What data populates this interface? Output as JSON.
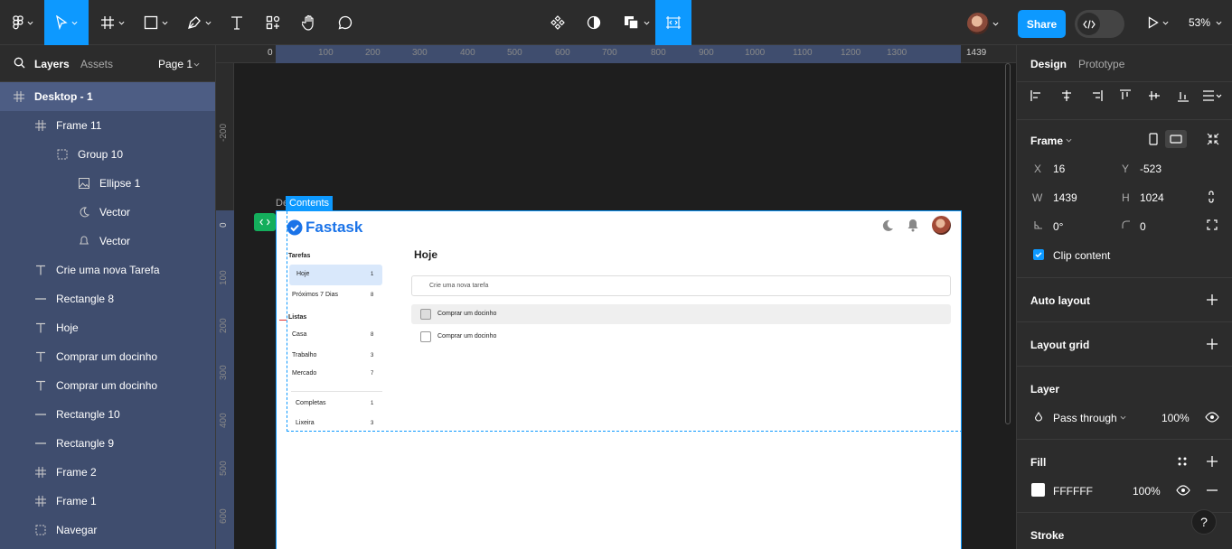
{
  "toolbar": {
    "zoom": "53%",
    "share_label": "Share"
  },
  "left_panel": {
    "tabs": [
      "Layers",
      "Assets"
    ],
    "page": "Page 1",
    "layers": [
      {
        "label": "Desktop - 1",
        "icon": "frame-icon"
      },
      {
        "label": "Frame 11",
        "icon": "frame-icon"
      },
      {
        "label": "Group 10",
        "icon": "group-icon"
      },
      {
        "label": "Ellipse 1",
        "icon": "image-icon"
      },
      {
        "label": "Vector",
        "icon": "moon-icon"
      },
      {
        "label": "Vector",
        "icon": "bell-icon"
      },
      {
        "label": "Crie uma nova Tarefa",
        "icon": "text-icon"
      },
      {
        "label": "Rectangle 8",
        "icon": "line-icon"
      },
      {
        "label": "Hoje",
        "icon": "text-icon"
      },
      {
        "label": "Comprar um docinho",
        "icon": "text-icon"
      },
      {
        "label": "Comprar um docinho",
        "icon": "text-icon"
      },
      {
        "label": "Rectangle 10",
        "icon": "line-icon"
      },
      {
        "label": "Rectangle 9",
        "icon": "line-icon"
      },
      {
        "label": "Frame 2",
        "icon": "frame-icon"
      },
      {
        "label": "Frame 1",
        "icon": "frame-icon"
      },
      {
        "label": "Navegar",
        "icon": "group-icon"
      }
    ]
  },
  "canvas": {
    "ruler_top": [
      "0",
      "100",
      "200",
      "300",
      "400",
      "500",
      "600",
      "700",
      "800",
      "900",
      "1000",
      "1100",
      "1200",
      "1300",
      "1439"
    ],
    "ruler_left": [
      "-200",
      "0",
      "100",
      "200",
      "300",
      "400",
      "500",
      "600",
      "700"
    ],
    "frame_label": "De",
    "selection_label": "Contents"
  },
  "app": {
    "logo": "Fastask",
    "sections": {
      "tarefas": "Tarefas",
      "listas": "Listas"
    },
    "nav": [
      {
        "label": "Hoje",
        "count": "1"
      },
      {
        "label": "Próximos 7 Dias",
        "count": "8"
      }
    ],
    "lists": [
      {
        "label": "Casa",
        "count": "8"
      },
      {
        "label": "Trabalho",
        "count": "3"
      },
      {
        "label": "Mercado",
        "count": "7"
      }
    ],
    "extra": [
      {
        "label": "Completas",
        "count": "1"
      },
      {
        "label": "Lixeira",
        "count": "3"
      }
    ],
    "page_title": "Hoje",
    "new_task_placeholder": "Crie uma nova tarefa",
    "tasks": [
      "Comprar um docinho",
      "Comprar um docinho"
    ]
  },
  "right_panel": {
    "tabs": [
      "Design",
      "Prototype"
    ],
    "frame_title": "Frame",
    "x_label": "X",
    "x_value": "16",
    "y_label": "Y",
    "y_value": "-523",
    "w_label": "W",
    "w_value": "1439",
    "h_label": "H",
    "h_value": "1024",
    "rotation_value": "0°",
    "radius_value": "0",
    "clip_content": "Clip content",
    "auto_layout": "Auto layout",
    "layout_grid": "Layout grid",
    "layer_title": "Layer",
    "blend_mode": "Pass through",
    "layer_opacity": "100%",
    "fill_title": "Fill",
    "fill_hex": "FFFFFF",
    "fill_opacity": "100%",
    "stroke_title": "Stroke",
    "help": "?"
  },
  "colors": {
    "accent": "#0d99ff",
    "app_brand": "#1a73e8"
  }
}
